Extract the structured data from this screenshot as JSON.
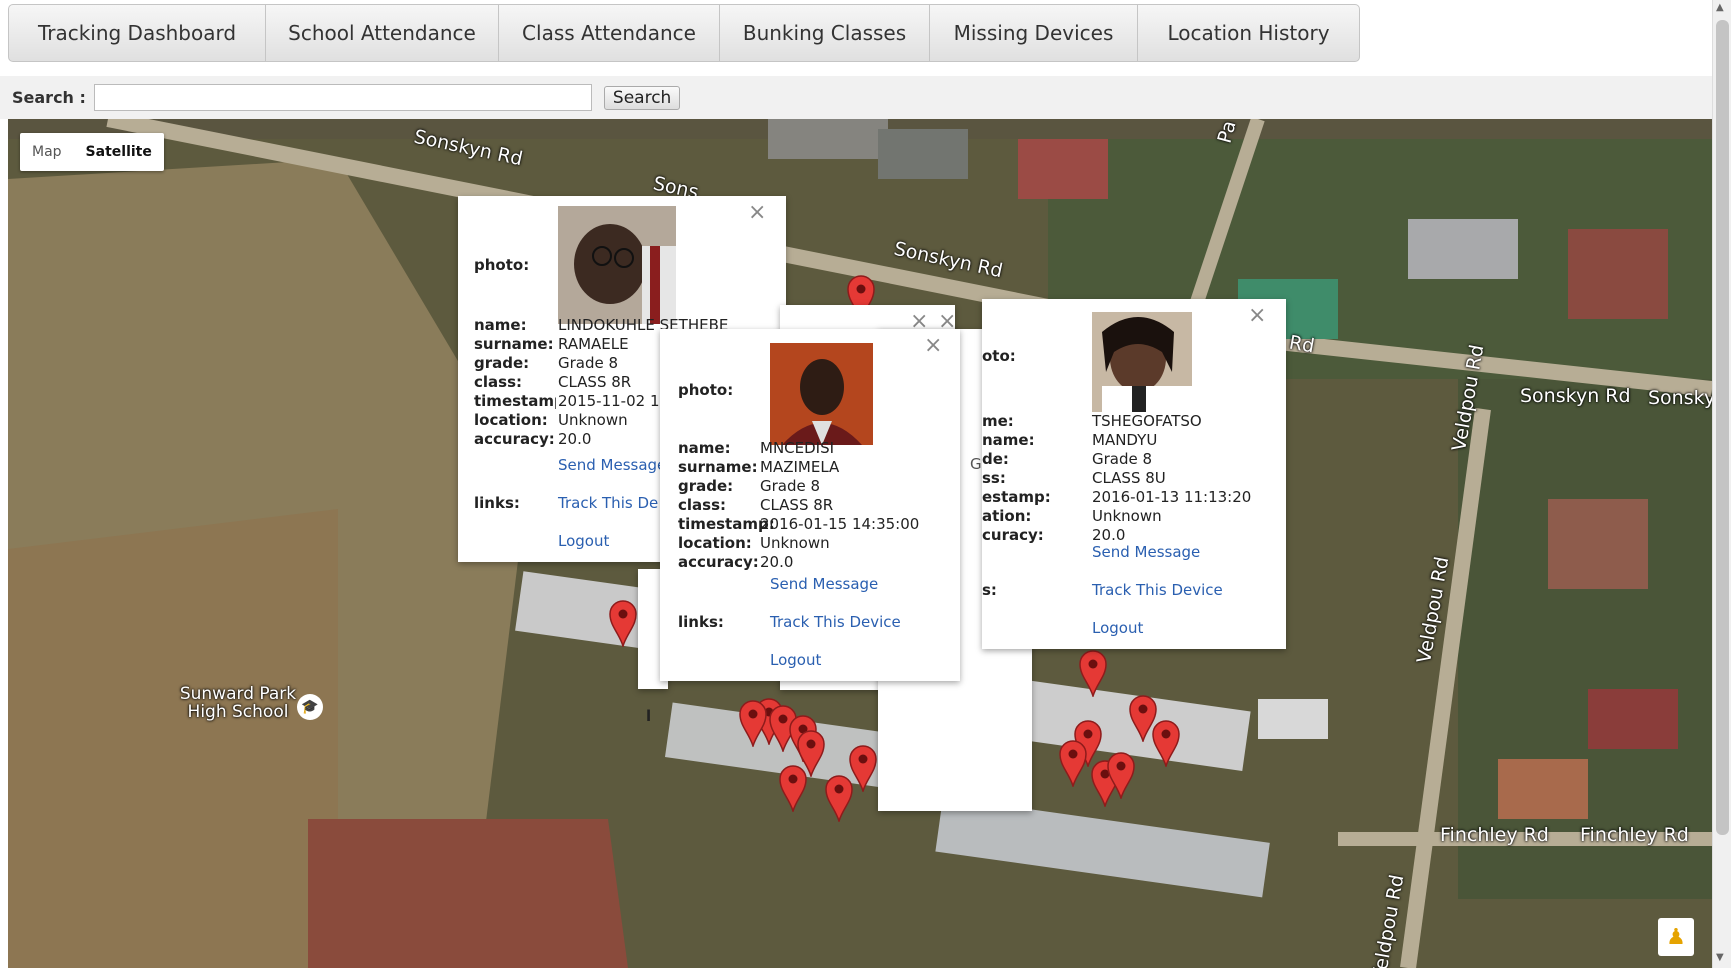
{
  "tabs": [
    "Tracking Dashboard",
    "School Attendance",
    "Class Attendance",
    "Bunking Classes",
    "Missing Devices",
    "Location History"
  ],
  "search": {
    "label": "Search :",
    "value": "",
    "button": "Search"
  },
  "map": {
    "type_map": "Map",
    "type_satellite": "Satellite",
    "selected": "Satellite",
    "roads": [
      "Sonskyn Rd",
      "Sonskyn Rd",
      "Sonskyn Rd",
      "Sonskyn Rd",
      "Sonsky",
      "Veldpou Rd",
      "Veldpou Rd",
      "Veldpou Rd",
      "Finchley Rd",
      "Finchley Rd",
      "yn Rd",
      "Pa",
      "Sons"
    ],
    "school": "Sunward Park High School"
  },
  "popups": [
    {
      "photo_label": "photo:",
      "fields": [
        {
          "k": "name:",
          "v": "LINDOKUHLE SETHEBE"
        },
        {
          "k": "surname:",
          "v": "RAMAELE"
        },
        {
          "k": "grade:",
          "v": "Grade 8"
        },
        {
          "k": "class:",
          "v": "CLASS 8R"
        },
        {
          "k": "timestamp:",
          "v": "2015-11-02 10"
        },
        {
          "k": "location:",
          "v": "Unknown"
        },
        {
          "k": "accuracy:",
          "v": "20.0"
        }
      ],
      "send": "Send Message",
      "links_label": "links:",
      "track": "Track This De",
      "logout": "Logout"
    },
    {
      "photo_label": "photo:",
      "fields": [
        {
          "k": "name:",
          "v": "MNCEDISI"
        },
        {
          "k": "surname:",
          "v": "MAZIMELA"
        },
        {
          "k": "grade:",
          "v": "Grade 8"
        },
        {
          "k": "class:",
          "v": "CLASS 8R"
        },
        {
          "k": "timestamp:",
          "v": "2016-01-15 14:35:00"
        },
        {
          "k": "location:",
          "v": "Unknown"
        },
        {
          "k": "accuracy:",
          "v": "20.0"
        }
      ],
      "send": "Send Message",
      "links_label": "links:",
      "track": "Track This Device",
      "logout": "Logout"
    },
    {
      "photo_label": "oto:",
      "fields": [
        {
          "k": "me:",
          "v": "TSHEGOFATSO"
        },
        {
          "k": "name:",
          "v": "MANDYU"
        },
        {
          "k": "de:",
          "v": "Grade 8"
        },
        {
          "k": "ss:",
          "v": "CLASS 8U"
        },
        {
          "k": "estamp:",
          "v": "2016-01-13 11:13:20"
        },
        {
          "k": "ation:",
          "v": "Unknown"
        },
        {
          "k": "curacy:",
          "v": "20.0"
        }
      ],
      "send": "Send Message",
      "links_label": "s:",
      "track": "Track This Device",
      "logout": "Logout"
    }
  ],
  "close_glyph": "×",
  "fragment_g": "G",
  "fragment_l": "l"
}
